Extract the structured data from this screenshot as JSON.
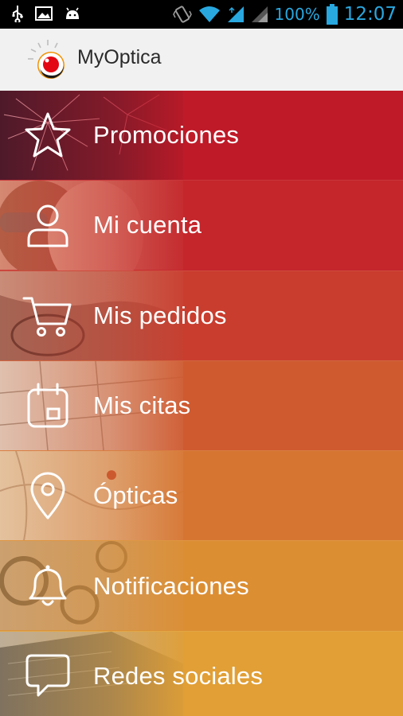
{
  "status_bar": {
    "battery_percent": "100%",
    "time": "12:07",
    "left_icons": [
      "usb-icon",
      "image-icon",
      "android-icon"
    ],
    "right_icons": [
      "vibrate-icon",
      "wifi-icon",
      "signal-icon",
      "signal-icon",
      "battery-icon"
    ]
  },
  "app_bar": {
    "title": "MyOptica",
    "logo_icon": "myoptica-logo-icon"
  },
  "menu": {
    "items": [
      {
        "label": "Promociones",
        "icon": "star-icon",
        "color": "#bf1a28"
      },
      {
        "label": "Mi cuenta",
        "icon": "user-icon",
        "color": "#c4262c"
      },
      {
        "label": "Mis pedidos",
        "icon": "cart-icon",
        "color": "#c93d2e"
      },
      {
        "label": "Mis citas",
        "icon": "calendar-icon",
        "color": "#cf5a30"
      },
      {
        "label": "Ópticas",
        "icon": "location-pin-icon",
        "color": "#d67532"
      },
      {
        "label": "Notificaciones",
        "icon": "bell-icon",
        "color": "#dc8e33"
      },
      {
        "label": "Redes sociales",
        "icon": "chat-bubble-icon",
        "color": "#e19f35"
      }
    ]
  },
  "colors": {
    "status_bar_bg": "#000000",
    "status_accent": "#29a8e0",
    "app_bar_bg": "#f1f1f1"
  }
}
